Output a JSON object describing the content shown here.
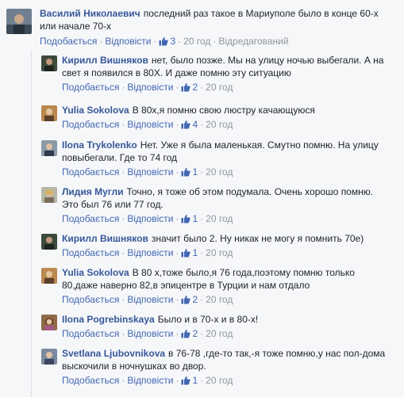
{
  "top_comment": {
    "author": "Василий Николаевич",
    "text": "последний раз такое в Мариуполе было в конце 60-х или начале 70-х",
    "like_label": "Подобається",
    "reply_label": "Відповісти",
    "likes": "3",
    "time": "20 год",
    "edited": "Відредагований"
  },
  "replies": [
    {
      "author": "Кирилл Вишняков",
      "text": "нет, было позже. Мы на улицу ночью выбегали. А на свет я появился в 80Х. И даже помню эту ситуацию",
      "like_label": "Подобається",
      "reply_label": "Відповісти",
      "likes": "2",
      "time": "20 год"
    },
    {
      "author": "Yulia Sokolova",
      "text": "В 80х,я помню свою люстру качающуюся",
      "like_label": "Подобається",
      "reply_label": "Відповісти",
      "likes": "4",
      "time": "20 год"
    },
    {
      "author": "Ilona Trykolenko",
      "text": "Нет. Уже я была маленькая. Смутно помню. На улицу повыбегали. Где то 74 год",
      "like_label": "Подобається",
      "reply_label": "Відповісти",
      "likes": "1",
      "time": "20 год"
    },
    {
      "author": "Лидия Мугли",
      "text": "Точно, я тоже об этом подумала. Очень хорошо помню. Это был 76 или 77 год.",
      "like_label": "Подобається",
      "reply_label": "Відповісти",
      "likes": "1",
      "time": "20 год"
    },
    {
      "author": "Кирилл Вишняков",
      "text": "значит было 2. Ну никак не могу я помнить 70е)",
      "like_label": "Подобається",
      "reply_label": "Відповісти",
      "likes": "1",
      "time": "20 год"
    },
    {
      "author": "Yulia Sokolova",
      "text": "В 80 х,тоже было,я 76 года,поэтому помню только 80,даже наверно 82,в эпицентре в Турции и нам отдало",
      "like_label": "Подобається",
      "reply_label": "Відповісти",
      "likes": "2",
      "time": "20 год"
    },
    {
      "author": "Ilona Pogrebinskaya",
      "text": "Было и в 70-х и в 80-х!",
      "like_label": "Подобається",
      "reply_label": "Відповісти",
      "likes": "2",
      "time": "20 год"
    },
    {
      "author": "Svetlana Ljubovnikova",
      "text": "в 76-78 ,где-то так,-я тоже помню,у нас пол-дома выскочили в ночнушках во двор.",
      "like_label": "Подобається",
      "reply_label": "Відповісти",
      "likes": "1",
      "time": "20 год"
    }
  ],
  "colors": {
    "name": "#365899",
    "link": "#4267b2",
    "meta": "#90949c",
    "text": "#1d2129",
    "background": "#f6f7f9"
  }
}
